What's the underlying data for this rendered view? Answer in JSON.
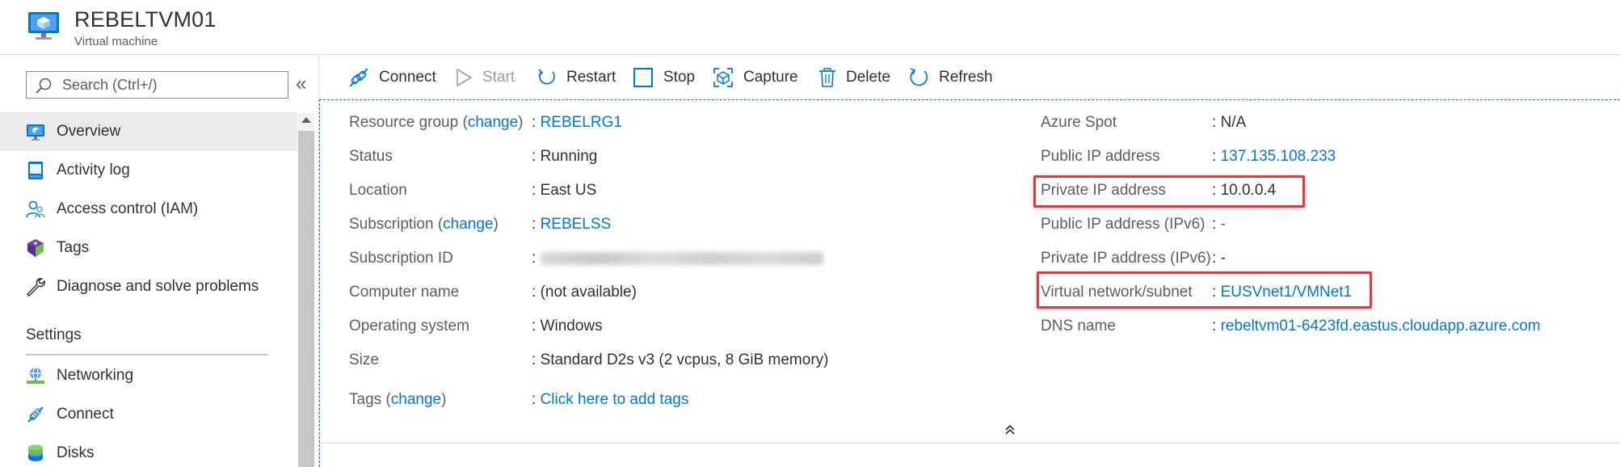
{
  "header": {
    "title": "REBELTVM01",
    "subtitle": "Virtual machine",
    "icon": "virtual-machine-icon"
  },
  "sidebar": {
    "search_placeholder": "Search (Ctrl+/)",
    "collapse_glyph": "«",
    "items": [
      {
        "label": "Overview",
        "icon": "overview-icon",
        "selected": true
      },
      {
        "label": "Activity log",
        "icon": "activity-log-icon"
      },
      {
        "label": "Access control (IAM)",
        "icon": "iam-icon"
      },
      {
        "label": "Tags",
        "icon": "tag-icon"
      },
      {
        "label": "Diagnose and solve problems",
        "icon": "wrench-icon"
      }
    ],
    "section": "Settings",
    "settings_items": [
      {
        "label": "Networking",
        "icon": "networking-icon"
      },
      {
        "label": "Connect",
        "icon": "connect-icon"
      },
      {
        "label": "Disks",
        "icon": "disks-icon"
      }
    ]
  },
  "toolbar": {
    "connect": "Connect",
    "start": "Start",
    "restart": "Restart",
    "stop": "Stop",
    "capture": "Capture",
    "delete": "Delete",
    "refresh": "Refresh"
  },
  "essentials": {
    "left": {
      "resource_group_label": "Resource group",
      "change": "change",
      "resource_group": "REBELRG1",
      "status_label": "Status",
      "status": "Running",
      "location_label": "Location",
      "location": "East US",
      "subscription_label": "Subscription",
      "subscription": "REBELSS",
      "subscription_id_label": "Subscription ID",
      "computer_name_label": "Computer name",
      "computer_name": "(not available)",
      "os_label": "Operating system",
      "os": "Windows",
      "size_label": "Size",
      "size": "Standard D2s v3 (2 vcpus, 8 GiB memory)",
      "tags_label": "Tags",
      "tags_link": "Click here to add tags"
    },
    "right": {
      "azure_spot_label": "Azure Spot",
      "azure_spot": "N/A",
      "public_ip_label": "Public IP address",
      "public_ip": "137.135.108.233",
      "private_ip_label": "Private IP address",
      "private_ip": "10.0.0.4",
      "public_ipv6_label": "Public IP address (IPv6)",
      "public_ipv6": "-",
      "private_ipv6_label": "Private IP address (IPv6)",
      "private_ipv6": "-",
      "vnet_label": "Virtual network/subnet",
      "vnet": "EUSVnet1/VMNet1",
      "dns_label": "DNS name",
      "dns": "rebeltvm01-6423fd.eastus.cloudapp.azure.com"
    }
  },
  "colors": {
    "link": "#0078d4",
    "highlight": "#e5383b",
    "selected_bg": "#edebe9"
  }
}
